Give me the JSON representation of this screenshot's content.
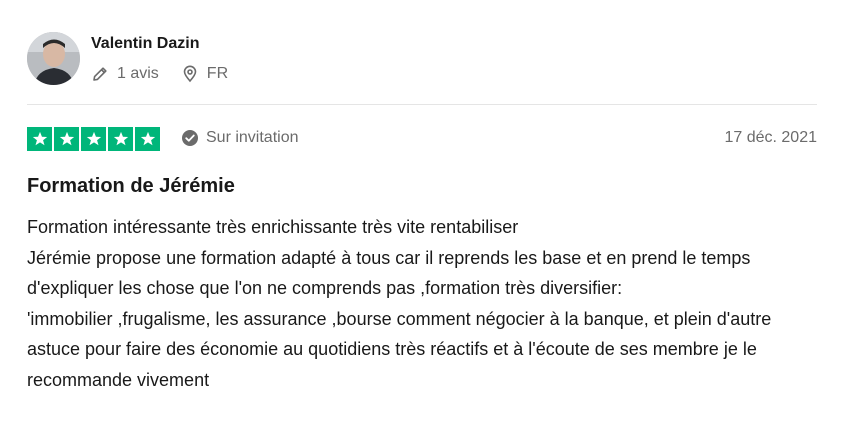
{
  "reviewer": {
    "name": "Valentin Dazin",
    "reviews_count": "1 avis",
    "country": "FR"
  },
  "review": {
    "rating": 5,
    "rating_max": 5,
    "verification": "Sur invitation",
    "date": "17 déc. 2021",
    "title": "Formation de Jérémie",
    "body_lines": [
      "Formation intéressante très enrichissante très vite rentabiliser",
      "Jérémie propose une formation adapté à tous car il reprends les base et en prend le temps d'expliquer les chose que l'on ne comprends pas ,formation très diversifier:",
      "'immobilier ,frugalisme, les assurance ,bourse comment négocier à la banque, et plein d'autre astuce pour faire des économie au quotidiens très réactifs et à l'écoute de ses membre je le recommande vivement"
    ]
  },
  "colors": {
    "star_green": "#00b67a",
    "text_dark": "#191919",
    "text_muted": "#6b6b6b",
    "divider": "#e5e5e5"
  },
  "icons": {
    "reviews": "pencil-icon",
    "country": "location-pin-icon",
    "verification": "check-circle-icon",
    "star": "star-icon"
  }
}
